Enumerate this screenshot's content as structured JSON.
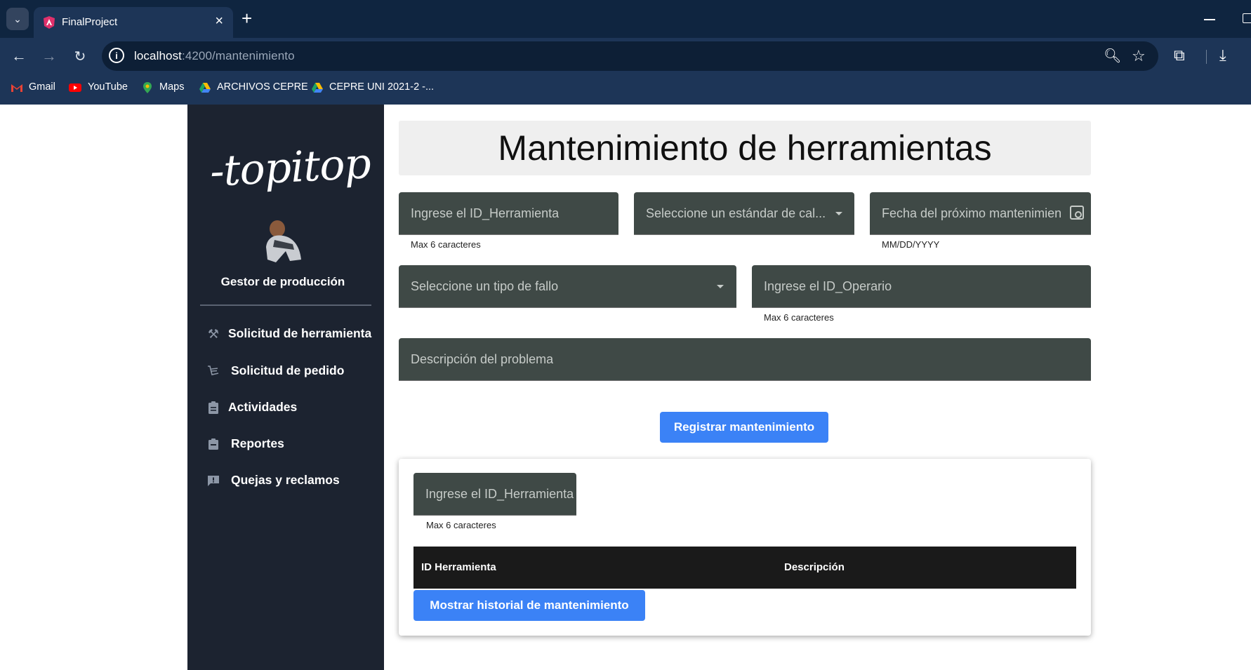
{
  "browser": {
    "tab_title": "FinalProject",
    "url_host": "localhost",
    "url_path": ":4200/mantenimiento",
    "bookmarks": [
      "Gmail",
      "YouTube",
      "Maps",
      "ARCHIVOS CEPRE",
      "CEPRE UNI 2021-2 -..."
    ]
  },
  "sidebar": {
    "logo_text": "-topitop",
    "role": "Gestor de producción",
    "items": [
      {
        "label": "Solicitud de herramienta",
        "icon": "tools-icon"
      },
      {
        "label": "Solicitud de pedido",
        "icon": "cart-icon"
      },
      {
        "label": "Actividades",
        "icon": "clipboard-icon"
      },
      {
        "label": "Reportes",
        "icon": "report-icon"
      },
      {
        "label": "Quejas y reclamos",
        "icon": "feedback-icon"
      }
    ]
  },
  "main": {
    "title": "Mantenimiento de herramientas",
    "form": {
      "id_herramienta_label": "Ingrese el ID_Herramienta",
      "id_herramienta_hint": "Max 6 caracteres",
      "estandar_label": "Seleccione un estándar de cal...",
      "fecha_label": "Fecha del próximo mantenimien",
      "fecha_hint": "MM/DD/YYYY",
      "tipo_fallo_label": "Seleccione un tipo de fallo",
      "id_operario_label": "Ingrese el ID_Operario",
      "id_operario_hint": "Max 6 caracteres",
      "descripcion_label": "Descripción del problema",
      "submit_label": "Registrar mantenimiento"
    },
    "history": {
      "search_label": "Ingrese el ID_Herramienta",
      "search_hint": "Max 6 caracteres",
      "columns": [
        "ID Herramienta",
        "Descripción"
      ],
      "show_button_label": "Mostrar historial de mantenimiento"
    }
  },
  "colors": {
    "chrome": "#1d3557",
    "sidebar": "#1c2330",
    "field": "#3f4946",
    "primary": "#3b82f6"
  }
}
